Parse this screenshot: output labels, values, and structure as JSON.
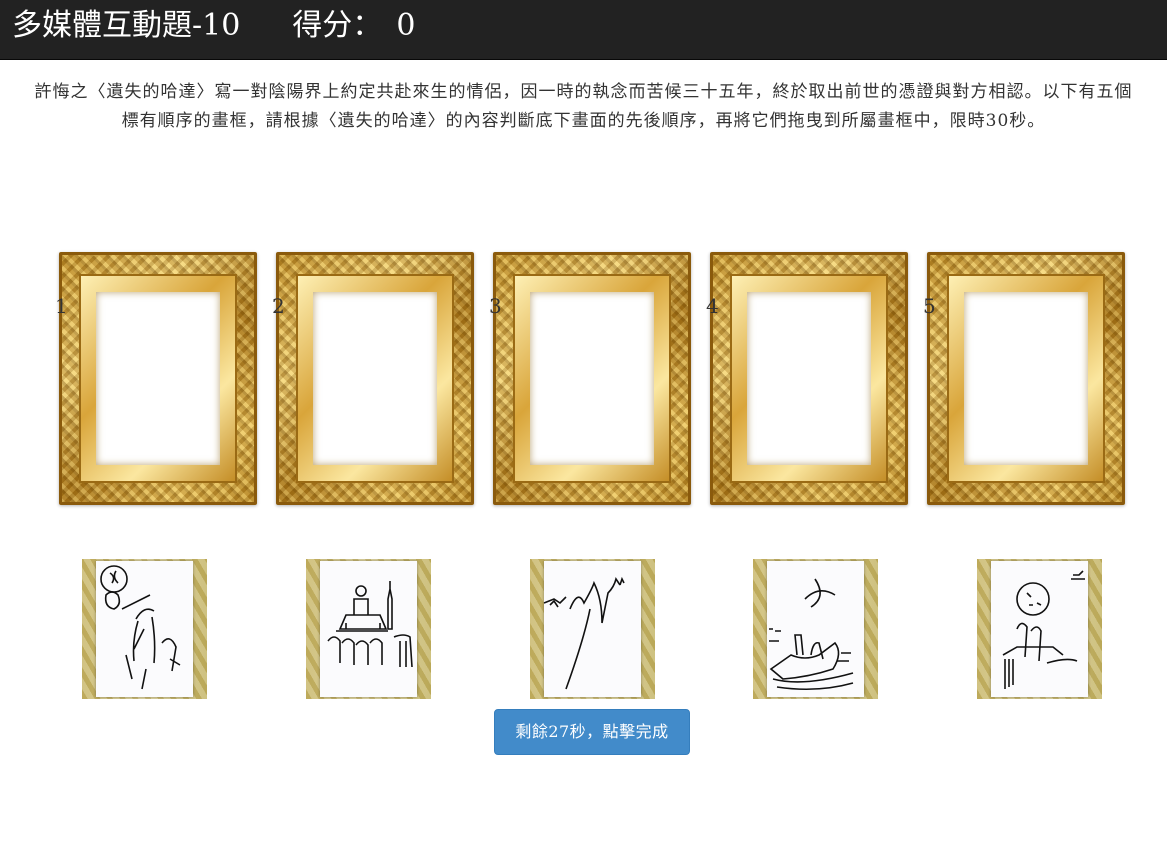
{
  "header": {
    "title": "多媒體互動題-10",
    "score_label": "得分：",
    "score_value": "0"
  },
  "instructions": "許悔之〈遺失的哈達〉寫一對陰陽界上約定共赴來生的情侶，因一時的執念而苦候三十五年，終於取出前世的憑證與對方相認。以下有五個標有順序的畫框，請根據〈遺失的哈達〉的內容判斷底下畫面的先後順序，再將它們拖曳到所屬畫框中，限時30秒。",
  "frames": [
    {
      "number": "1"
    },
    {
      "number": "2"
    },
    {
      "number": "3"
    },
    {
      "number": "4"
    },
    {
      "number": "5"
    }
  ],
  "cards": [
    {
      "icon": "sketch-couple-moon-icon"
    },
    {
      "icon": "sketch-altar-crowd-icon"
    },
    {
      "icon": "sketch-mountains-icon"
    },
    {
      "icon": "sketch-boat-moon-icon"
    },
    {
      "icon": "sketch-figures-full-moon-icon"
    }
  ],
  "done_button": {
    "label": "剩餘27秒，點擊完成"
  },
  "colors": {
    "header_bg": "#222222",
    "button_bg": "#428bca",
    "frame_gold": "#d4a43a"
  }
}
